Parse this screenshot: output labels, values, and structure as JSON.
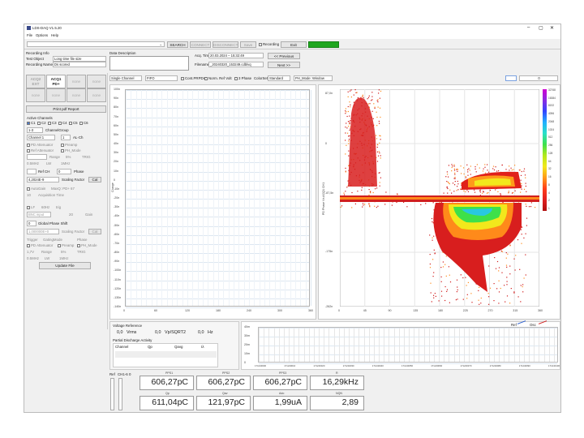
{
  "window": {
    "title": "LDS-DAQ V1.5.20",
    "controls": [
      "–",
      "▢",
      "✕"
    ]
  },
  "menu": [
    "File",
    "Options",
    "Help"
  ],
  "toolbar": {
    "search": "SEARCH",
    "connect": "CONNECT",
    "disconnect": "DISCONNECT",
    "save": "Save",
    "recording": "Recording",
    "exit": "Exit",
    "status_color": "#1fa61f"
  },
  "recording_info": {
    "header": "Recording Info",
    "test_object_label": "Test Object",
    "test_object_value": "Long time file size",
    "recording_name_label": "Recording Name",
    "recording_name_value": "Ds scored"
  },
  "data_description": {
    "header": "Data Description"
  },
  "acq": {
    "time_label": "Acq. Time",
    "time_value": "20.03.2024 – 15:32:49",
    "filename_label": "Filename",
    "filename_value": "_20240320_153249.cdblvq",
    "prev": "<< Previous",
    "next": "Next >>"
  },
  "acq_grid": [
    "ACQ2 EXT",
    "ACQ1 PD+",
    "none",
    "none",
    "none",
    "none",
    "none",
    "none"
  ],
  "print_pdf": "Print pdf Report",
  "channels": {
    "header": "Active Channels",
    "list": [
      "C1",
      "C2",
      "C3",
      "C4",
      "C5",
      "C6"
    ],
    "group_value": "1-3",
    "group_label": "ChannelGroup",
    "channel_value": "Channel 1",
    "ch_right": "1",
    "ch_right2": "AL-Ch"
  },
  "settings": {
    "pd_att": "PD Attenuator",
    "preamp": "Preamp",
    "ref_att": "Ref Attenuator",
    "ph_mode": "PH_Mode",
    "range_label": "Range",
    "range_val": "5%",
    "trig": "TRIG",
    "low": "LW",
    "filter_val": "0.5MHz",
    "high": "1MHz",
    "ref_ch": "Ref CH",
    "phase_label": "Phase",
    "phase_val": "0",
    "scaling_val": "4,2024E-9",
    "scaling_label": "Scaling Factor",
    "cal": "Cal"
  },
  "acq_settings": {
    "autogain": "AutoGain",
    "max_label": "MaxQ: PD+ 67",
    "acq_time": "Acquisition Time",
    "acq_time_val": "10"
  },
  "trigger_section": {
    "lf": "LF",
    "freq": "60Hz",
    "trig": "trig",
    "input": "BNC input",
    "gain_label": "Gain",
    "gain_val": "20",
    "global_phase_val": "0",
    "global_phase_label": "Global Phase Shift",
    "scaling_val": "1,000000E+0",
    "scaling_label": "Scaling Factor",
    "cal": "Cal"
  },
  "trigger2": {
    "trigger": "Trigger",
    "gating": "GatingMode",
    "phase": "Phase",
    "pd_att": "PD Attenuator",
    "preamp": "Preamp",
    "ph_mode": "PH_Mode",
    "range_val": "1,7V",
    "range_label": "Range",
    "pct": "5%",
    "trig": "TRIG",
    "filter_val": "0.5MHz",
    "low": "LW",
    "high": "1MHz",
    "update": "Update File"
  },
  "plot_toolbar": {
    "mode": "Single Channel",
    "order": "FIFO",
    "cont_pd": "Cont.PRPDs",
    "norm": "Norm. Ref Volt",
    "three_phase": "3 Phase",
    "colorset_label": "ColorSet",
    "colorset_val": "Standard",
    "ph_mode": "PH_Mode: Window",
    "value": "0"
  },
  "left_plot": {
    "ylabel": "Charge",
    "yticks": [
      "100n",
      "90n",
      "80n",
      "70n",
      "60n",
      "50n",
      "40n",
      "30n",
      "20n",
      "10n",
      "0",
      "-10n",
      "-20n",
      "-30n",
      "-40n",
      "-50n",
      "-60n",
      "-70n",
      "-80n",
      "-90n",
      "-100n",
      "-110n",
      "-120n",
      "-130n",
      "-140n"
    ],
    "xticks": [
      "0",
      "60",
      "120",
      "180",
      "240",
      "300",
      "360"
    ]
  },
  "right_plot": {
    "ylabel": "PD Phase Vs ACQ1 CH1",
    "yticks": [
      "87,0n",
      "0",
      "-87,5n",
      "-175n",
      "-262n"
    ],
    "xticks": [
      "0",
      "45",
      "90",
      "135",
      "180",
      "225",
      "270",
      "315",
      "360"
    ],
    "colorbar": [
      "32768",
      "16384",
      "8192",
      "4096",
      "2048",
      "1024",
      "512",
      "256",
      "128",
      "64",
      "32",
      "16",
      "8",
      "4",
      "2",
      "1"
    ]
  },
  "voltage_ref": {
    "header": "Voltage Reference",
    "vrms_val": "0,0",
    "vrms_unit": "Vrms",
    "vp_val": "0,0",
    "vp_unit": "Vp/SQRT2",
    "hz_val": "0,0",
    "hz_unit": "Hz"
  },
  "pd_activity": {
    "header": "Partial Discharge Activity",
    "cols": [
      "Channel",
      "Qp",
      "Qavg",
      "Iλ"
    ]
  },
  "timeline": {
    "ref": "Ref",
    "osc": "Osc",
    "yticks": [
      "40m",
      "30m",
      "20m",
      "10m",
      "0"
    ],
    "xticks": [
      "171240000",
      "171240010",
      "171240020",
      "171240030",
      "171240040",
      "171240050",
      "171240060",
      "171240070",
      "171240080",
      "171240090",
      "171240100"
    ]
  },
  "bottom": {
    "ref": "Ref",
    "ch": "CH1-6",
    "zero": "0",
    "row1_labels": [
      "PPS1",
      "PPS2",
      "PPS3",
      "R"
    ],
    "row1_values": [
      "606,27pC",
      "606,27pC",
      "606,27pC",
      "16,29kHz"
    ],
    "row2_labels": [
      "Qp",
      "Qav",
      "Ado",
      "NQN"
    ],
    "row2_values": [
      "611,04pC",
      "121,97pC",
      "1,99uA",
      "2,89"
    ]
  }
}
